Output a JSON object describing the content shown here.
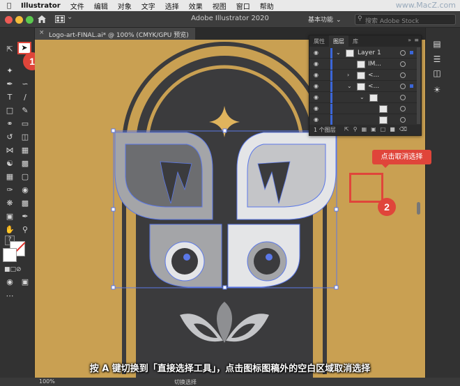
{
  "menubar": {
    "app_name": "Illustrator",
    "items": [
      "文件",
      "编辑",
      "对象",
      "文字",
      "选择",
      "效果",
      "视图",
      "窗口",
      "帮助"
    ],
    "watermark": "www.MacZ.com"
  },
  "appbar": {
    "title": "Adobe Illustrator 2020",
    "workspace": "基本功能",
    "search_placeholder": "搜索 Adobe Stock"
  },
  "document_tab": {
    "label": "Logo-art-FINAL.ai* @ 100% (CMYK/GPU 预览)"
  },
  "toolbar": {
    "question_mark": "?",
    "step1_badge": "1"
  },
  "layers_panel": {
    "tabs": [
      "属性",
      "图层",
      "库"
    ],
    "active_tab": "图层",
    "rows": [
      {
        "name": "Layer 1"
      },
      {
        "name": "IM..."
      },
      {
        "name": "<..."
      },
      {
        "name": "<..."
      },
      {
        "name": ""
      },
      {
        "name": ""
      },
      {
        "name": ""
      }
    ],
    "footer_count": "1 个图层"
  },
  "canvas": {
    "callout_text": "点击取消选择",
    "step2_badge": "2",
    "artboard_bg": "#c9a052",
    "art_dark": "#3b3b3d",
    "art_gold": "#e0b45d",
    "selection_color": "#5b78e8"
  },
  "subtitle": "按 A 键切换到「直接选择工具」，点击图标图稿外的空白区域取消选择",
  "statusbar": {
    "zoom": "100%",
    "tool_status": "切换选择"
  },
  "colors": {
    "accent_red": "#e0453a",
    "layer_blue": "#3b66d8"
  }
}
